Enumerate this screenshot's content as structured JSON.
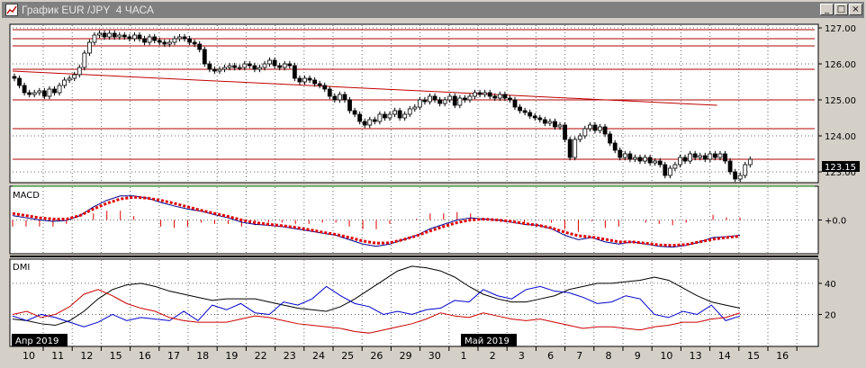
{
  "window": {
    "title": "График EUR /JPY  4 ЧАСА",
    "buttons": {
      "minimize": "_",
      "maximize": "□",
      "close": "×"
    }
  },
  "colors": {
    "background": "#ffffff",
    "frame": "#d4d0c8",
    "grid": "#000000",
    "levels": "#b00000",
    "trendline": "#c00000",
    "support": "#008000",
    "price_tag": "#000000",
    "macd_line": "#00008b",
    "signal": "#dd0000",
    "histogram": "#dd0000",
    "dmi_adx": "#000000",
    "dmi_plus": "#0000cc",
    "dmi_minus": "#cc0000"
  },
  "chart_data": [
    {
      "type": "candlestick",
      "title": "",
      "ylim": [
        122.7,
        127.1
      ],
      "price_ticks": [
        "127.00",
        "126.00",
        "125.00",
        "124.00",
        "123.00"
      ],
      "last_price": "123.15",
      "horizontal_levels": [
        126.95,
        126.7,
        126.5,
        125.85,
        125.0,
        124.2,
        123.35,
        122.6
      ],
      "trendline": {
        "from": [
          0,
          125.8
        ],
        "to": [
          34.5,
          124.85
        ]
      },
      "x_labels": [
        "10",
        "11",
        "12",
        "15",
        "16",
        "17",
        "18",
        "19",
        "22",
        "23",
        "24",
        "25",
        "26",
        "29",
        "30",
        "1",
        "2",
        "3",
        "6",
        "7",
        "8",
        "9",
        "10",
        "13",
        "14",
        "15",
        "16"
      ],
      "month_labels": [
        {
          "at": 0,
          "text": "Апр 2019"
        },
        {
          "at": 15,
          "text": "Май 2019"
        }
      ],
      "closes": [
        125.6,
        125.4,
        125.2,
        125.15,
        125.2,
        125.25,
        125.1,
        125.3,
        125.2,
        125.4,
        125.55,
        125.6,
        125.7,
        125.9,
        126.3,
        126.6,
        126.8,
        126.85,
        126.75,
        126.85,
        126.75,
        126.8,
        126.75,
        126.7,
        126.8,
        126.7,
        126.6,
        126.75,
        126.65,
        126.6,
        126.55,
        126.6,
        126.7,
        126.75,
        126.7,
        126.6,
        126.55,
        126.4,
        126.0,
        125.85,
        125.8,
        125.85,
        125.9,
        125.95,
        125.9,
        125.9,
        126.0,
        125.95,
        125.85,
        125.9,
        126.0,
        126.1,
        125.95,
        125.9,
        126.0,
        125.95,
        125.6,
        125.5,
        125.6,
        125.55,
        125.45,
        125.4,
        125.3,
        125.1,
        125.0,
        125.15,
        125.0,
        124.7,
        124.6,
        124.4,
        124.3,
        124.45,
        124.4,
        124.6,
        124.5,
        124.6,
        124.7,
        124.5,
        124.6,
        124.75,
        124.8,
        125.0,
        124.95,
        125.1,
        125.0,
        124.9,
        125.0,
        125.1,
        124.85,
        125.05,
        125.0,
        125.1,
        125.2,
        125.15,
        125.2,
        125.1,
        125.05,
        125.15,
        125.05,
        125.0,
        124.8,
        124.7,
        124.65,
        124.55,
        124.5,
        124.45,
        124.35,
        124.4,
        124.25,
        124.3,
        123.9,
        123.4,
        123.9,
        124.0,
        124.2,
        124.3,
        124.15,
        124.25,
        124.05,
        123.8,
        123.6,
        123.4,
        123.5,
        123.35,
        123.4,
        123.3,
        123.4,
        123.25,
        123.3,
        123.2,
        122.9,
        123.1,
        123.2,
        123.4,
        123.3,
        123.5,
        123.4,
        123.45,
        123.35,
        123.5,
        123.4,
        123.5,
        123.3,
        123.0,
        122.8,
        122.9,
        123.2,
        123.35
      ]
    },
    {
      "type": "line",
      "title": "MACD",
      "zero_label": "+0.0",
      "ylim": [
        -0.75,
        0.75
      ],
      "series": [
        {
          "values": [
            0.1,
            0.05,
            0.0,
            -0.03,
            -0.01,
            0.1,
            0.3,
            0.45,
            0.55,
            0.55,
            0.5,
            0.4,
            0.32,
            0.25,
            0.2,
            0.12,
            0.05,
            -0.05,
            -0.1,
            -0.12,
            -0.15,
            -0.2,
            -0.25,
            -0.3,
            -0.35,
            -0.45,
            -0.55,
            -0.6,
            -0.55,
            -0.45,
            -0.35,
            -0.2,
            -0.1,
            0.0,
            0.05,
            0.02,
            0.0,
            -0.05,
            -0.1,
            -0.12,
            -0.2,
            -0.35,
            -0.45,
            -0.4,
            -0.5,
            -0.55,
            -0.5,
            -0.55,
            -0.6,
            -0.62,
            -0.58,
            -0.5,
            -0.4,
            -0.38,
            -0.35
          ]
        },
        {
          "values": [
            0.15,
            0.1,
            0.05,
            0.02,
            0.02,
            0.1,
            0.25,
            0.38,
            0.48,
            0.52,
            0.5,
            0.45,
            0.38,
            0.3,
            0.22,
            0.15,
            0.08,
            0.0,
            -0.06,
            -0.1,
            -0.13,
            -0.17,
            -0.22,
            -0.28,
            -0.33,
            -0.4,
            -0.48,
            -0.53,
            -0.52,
            -0.45,
            -0.36,
            -0.25,
            -0.15,
            -0.06,
            0.0,
            0.02,
            0.0,
            -0.03,
            -0.08,
            -0.12,
            -0.18,
            -0.28,
            -0.36,
            -0.39,
            -0.44,
            -0.5,
            -0.5,
            -0.53,
            -0.57,
            -0.58,
            -0.56,
            -0.5,
            -0.44,
            -0.4,
            -0.37
          ]
        },
        {
          "values": [
            -0.05,
            -0.05,
            -0.05,
            -0.05,
            -0.03,
            0.0,
            0.05,
            0.07,
            0.07,
            0.03,
            0.0,
            -0.05,
            -0.06,
            -0.05,
            -0.02,
            -0.03,
            -0.03,
            -0.05,
            -0.04,
            -0.02,
            -0.02,
            -0.03,
            -0.03,
            -0.02,
            -0.02,
            -0.05,
            -0.07,
            -0.07,
            -0.03,
            0.0,
            0.01,
            0.05,
            0.05,
            0.06,
            0.05,
            0.0,
            0.0,
            -0.02,
            -0.02,
            0.0,
            -0.02,
            -0.07,
            -0.09,
            -0.01,
            -0.06,
            -0.05,
            0.0,
            -0.02,
            -0.03,
            -0.04,
            -0.02,
            0.0,
            0.04,
            0.02,
            0.02
          ]
        }
      ]
    },
    {
      "type": "line",
      "title": "DMI",
      "ylim": [
        0,
        55
      ],
      "y_ticks": [
        "40",
        "20"
      ],
      "series": [
        {
          "values": [
            17,
            16,
            14,
            13,
            16,
            22,
            30,
            36,
            39,
            40,
            38,
            35,
            33,
            31,
            29,
            30,
            30,
            30,
            28,
            26,
            24,
            23,
            22,
            25,
            30,
            36,
            42,
            48,
            51,
            50,
            48,
            44,
            38,
            33,
            30,
            28,
            28,
            30,
            32,
            36,
            38,
            40,
            40,
            41,
            42,
            44,
            42,
            37,
            32,
            28,
            26,
            24
          ]
        },
        {
          "values": [
            19,
            16,
            20,
            18,
            15,
            12,
            15,
            20,
            16,
            18,
            17,
            16,
            22,
            16,
            26,
            23,
            27,
            21,
            20,
            28,
            26,
            30,
            38,
            32,
            27,
            25,
            20,
            22,
            20,
            23,
            24,
            29,
            28,
            36,
            32,
            30,
            36,
            38,
            35,
            34,
            31,
            27,
            28,
            32,
            30,
            20,
            18,
            22,
            20,
            26,
            16,
            19
          ]
        },
        {
          "values": [
            20,
            22,
            18,
            20,
            25,
            33,
            36,
            32,
            27,
            24,
            22,
            18,
            16,
            15,
            15,
            15,
            17,
            19,
            18,
            16,
            14,
            13,
            12,
            11,
            9,
            8,
            10,
            12,
            14,
            17,
            21,
            19,
            18,
            21,
            19,
            17,
            16,
            17,
            15,
            13,
            11,
            12,
            12,
            11,
            10,
            12,
            13,
            15,
            15,
            17,
            18,
            21
          ]
        }
      ]
    }
  ]
}
